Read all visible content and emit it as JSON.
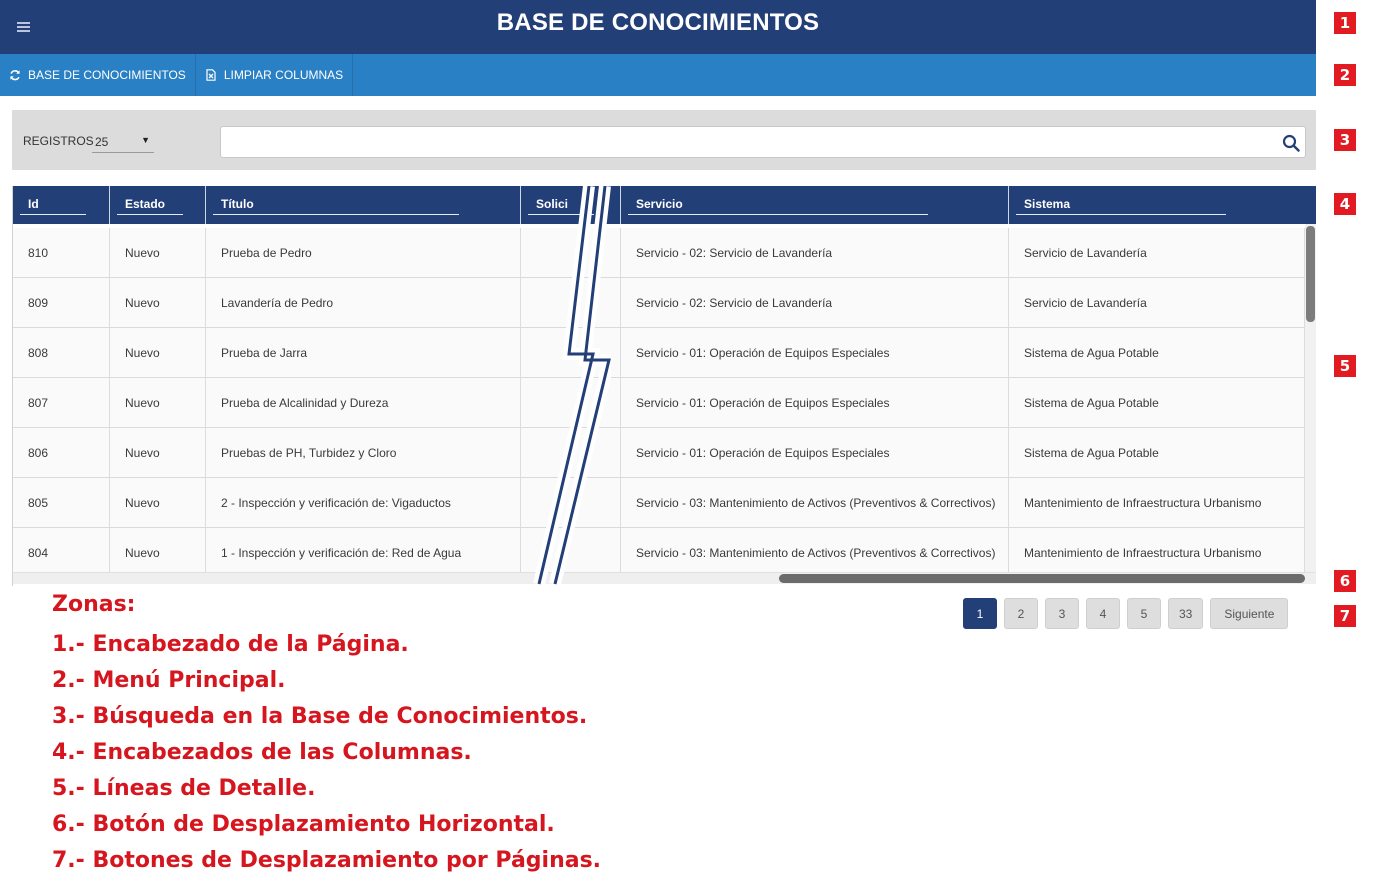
{
  "header": {
    "title": "BASE DE CONOCIMIENTOS",
    "menu_icon": "hamburger-icon"
  },
  "menu": {
    "items": [
      {
        "label": "BASE DE CONOCIMIENTOS",
        "icon": "refresh-icon"
      },
      {
        "label": "LIMPIAR COLUMNAS",
        "icon": "excel-file-icon"
      }
    ]
  },
  "search": {
    "records_label": "REGISTROS",
    "records_value": "25",
    "placeholder": "",
    "icon": "search-icon"
  },
  "table": {
    "columns": [
      "Id",
      "Estado",
      "Título",
      "Solici",
      "Servicio",
      "Sistema"
    ],
    "rows": [
      {
        "id": "810",
        "estado": "Nuevo",
        "titulo": "Prueba de Pedro",
        "servicio": "Servicio - 02: Servicio de Lavandería",
        "sistema": "Servicio de Lavandería"
      },
      {
        "id": "809",
        "estado": "Nuevo",
        "titulo": "Lavandería de Pedro",
        "servicio": "Servicio - 02: Servicio de Lavandería",
        "sistema": "Servicio de Lavandería"
      },
      {
        "id": "808",
        "estado": "Nuevo",
        "titulo": "Prueba de Jarra",
        "servicio": "Servicio - 01: Operación de Equipos Especiales",
        "sistema": "Sistema de Agua Potable"
      },
      {
        "id": "807",
        "estado": "Nuevo",
        "titulo": "Prueba de Alcalinidad y Dureza",
        "servicio": "Servicio - 01: Operación de Equipos Especiales",
        "sistema": "Sistema de Agua Potable"
      },
      {
        "id": "806",
        "estado": "Nuevo",
        "titulo": "Pruebas de PH, Turbidez y Cloro",
        "servicio": "Servicio - 01: Operación de Equipos Especiales",
        "sistema": "Sistema de Agua Potable"
      },
      {
        "id": "805",
        "estado": "Nuevo",
        "titulo": "2 - Inspección y verificación de: Vigaductos",
        "servicio": "Servicio - 03: Mantenimiento de Activos (Preventivos & Correctivos)",
        "sistema": "Mantenimiento de Infraestructura Urbanismo"
      },
      {
        "id": "804",
        "estado": "Nuevo",
        "titulo": "1 - Inspección y verificación de: Red de Agua",
        "servicio": "Servicio - 03: Mantenimiento de Activos (Preventivos & Correctivos)",
        "sistema": "Mantenimiento de Infraestructura Urbanismo"
      }
    ]
  },
  "pagination": {
    "pages": [
      "1",
      "2",
      "3",
      "4",
      "5",
      "33"
    ],
    "active": "1",
    "next_label": "Siguiente"
  },
  "zones": [
    "1",
    "2",
    "3",
    "4",
    "5",
    "6",
    "7"
  ],
  "legend": {
    "title": "Zonas:",
    "items": [
      "1.- Encabezado de la Página.",
      "2.- Menú Principal.",
      "3.- Búsqueda en la Base de Conocimientos.",
      "4.- Encabezados de las Columnas.",
      "5.- Líneas de Detalle.",
      "6.- Botón de Desplazamiento Horizontal.",
      "7.- Botones de Desplazamiento por Páginas."
    ]
  },
  "colors": {
    "header": "#233f78",
    "menubar": "#2a80c4",
    "zone_marker": "#e21a22",
    "legend_text": "#d6161f"
  }
}
